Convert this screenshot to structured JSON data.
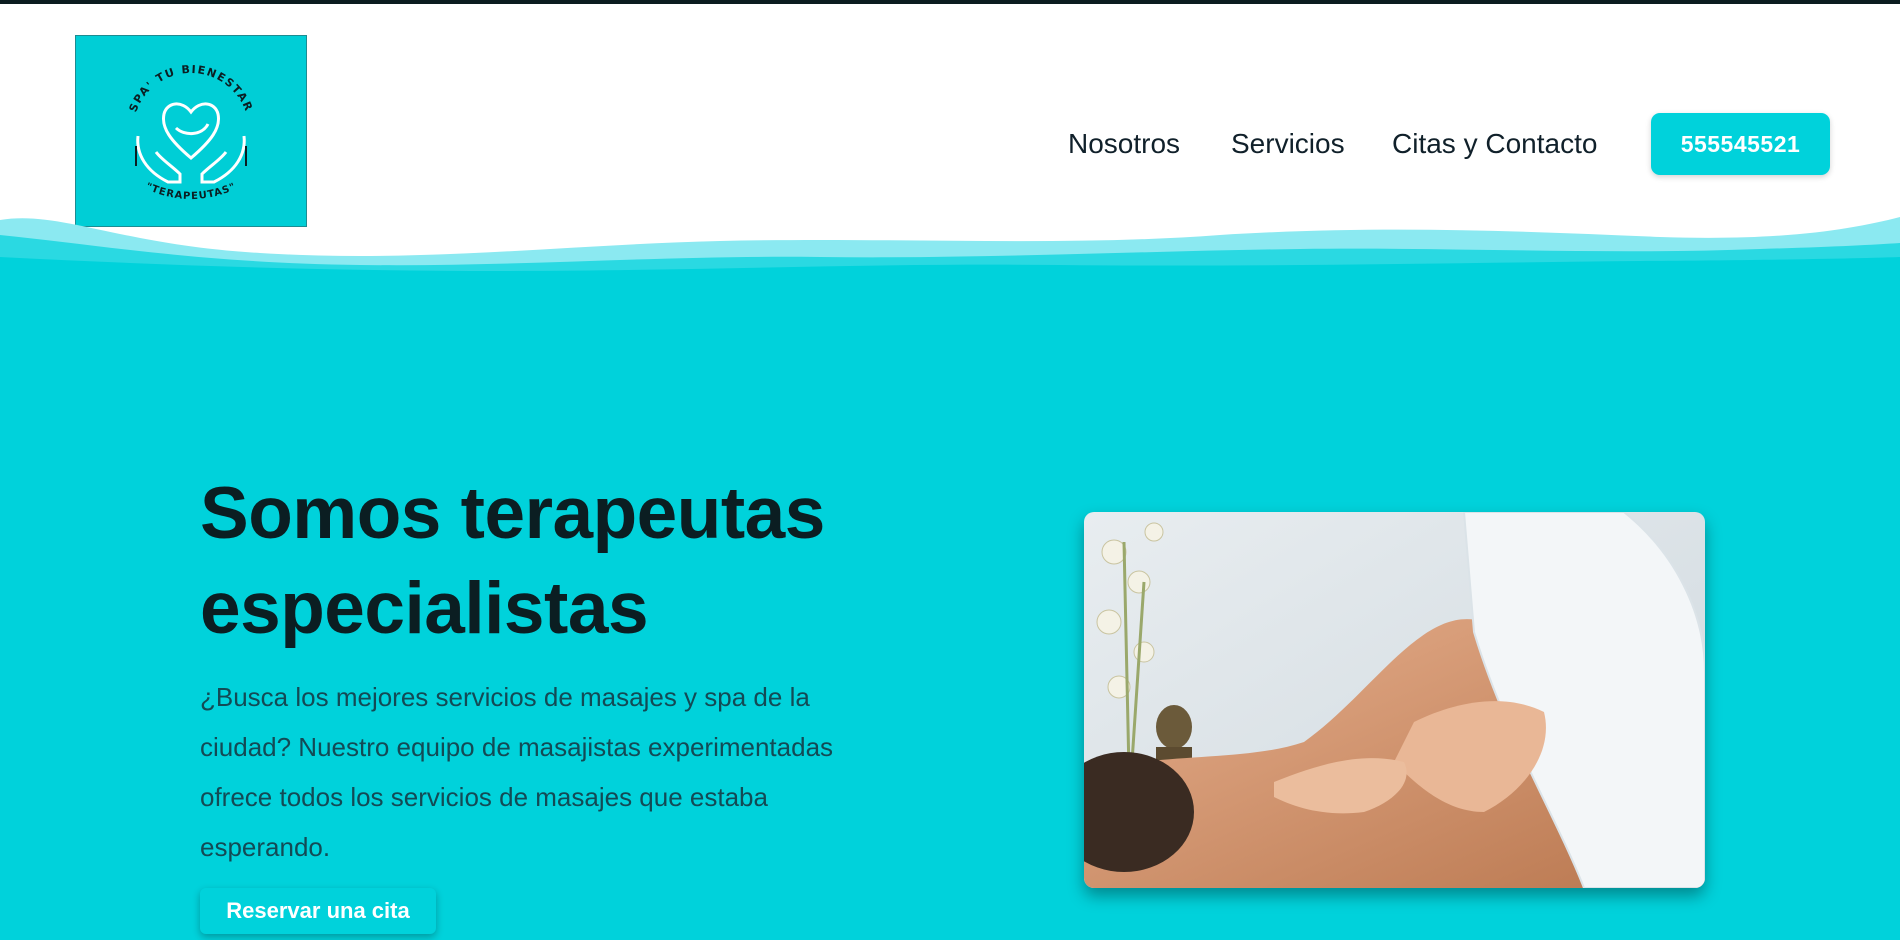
{
  "brand": {
    "logo_text_top": "SPA' TU BIENESTAR",
    "logo_text_bottom": "\"TERAPEUTAS\"",
    "logo_color": "#00ced6"
  },
  "nav": {
    "items": [
      {
        "label": "Nosotros"
      },
      {
        "label": "Servicios"
      },
      {
        "label": "Citas y Contacto"
      }
    ],
    "phone_button": "555545521"
  },
  "hero": {
    "title": "Somos terapeutas especialistas",
    "description": "¿Busca los mejores servicios de masajes y spa de la ciudad? Nuestro equipo de masajistas experimentadas ofrece todos los servicios de masajes que estaba esperando.",
    "cta_label": "Reservar una cita"
  },
  "colors": {
    "accent": "#00d2db",
    "header_bg": "#ffffff",
    "heading": "#0b1e22",
    "body_text": "#134a55"
  },
  "icons": {
    "logo": "heart-in-hands-icon"
  }
}
